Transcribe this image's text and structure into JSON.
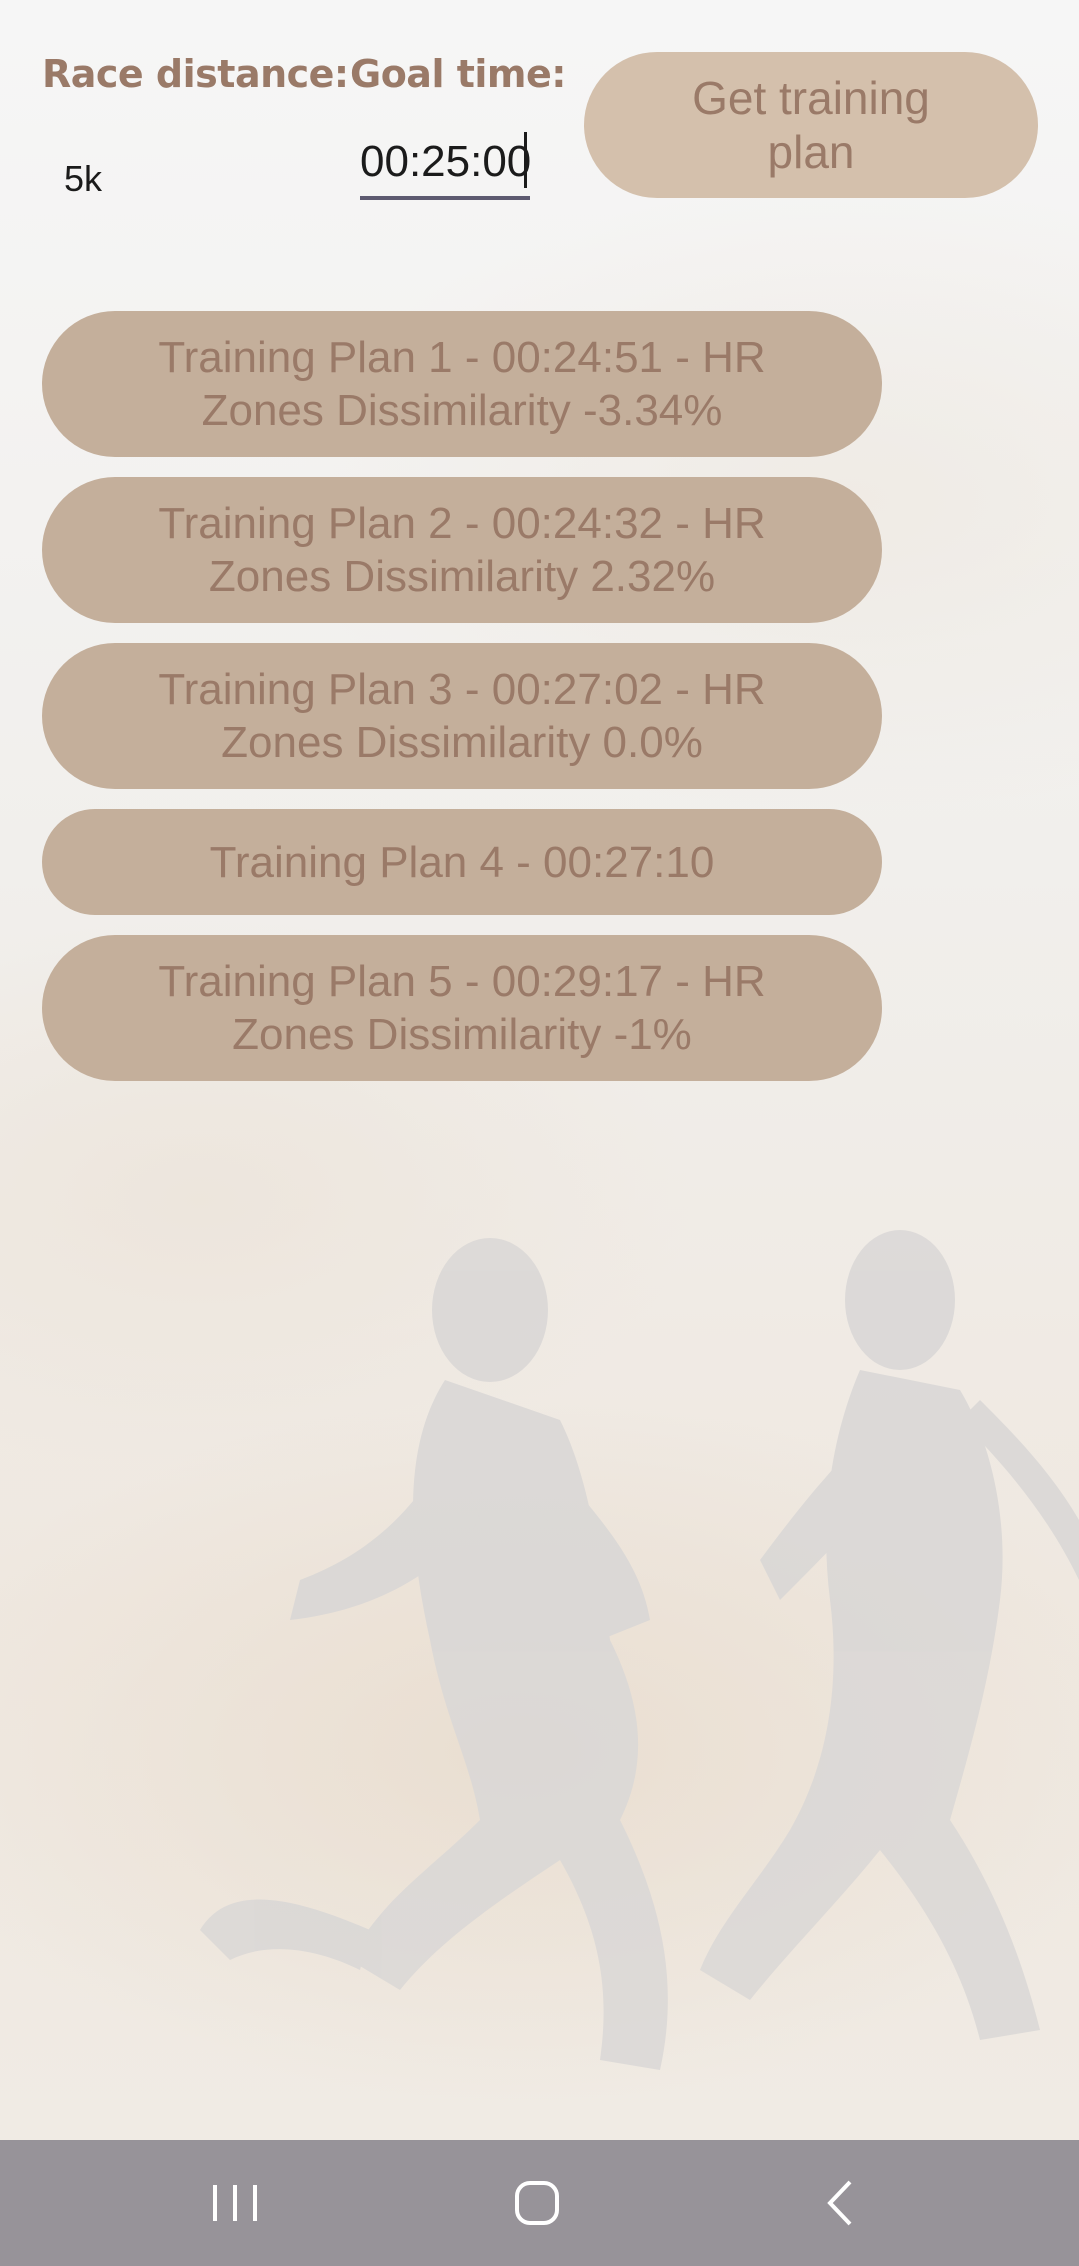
{
  "form": {
    "race_distance_label": "Race distance:",
    "goal_time_label": "Goal time:",
    "race_distance_value": "5k",
    "goal_time_value": "00:25:00",
    "get_plan_label": "Get training plan"
  },
  "plans": [
    "Training Plan 1 - 00:24:51 - HR Zones Dissimilarity -3.34%",
    "Training Plan 2 - 00:24:32 - HR Zones Dissimilarity 2.32%",
    "Training Plan 3 - 00:27:02 - HR Zones Dissimilarity 0.0%",
    "Training Plan 4 - 00:27:10",
    "Training Plan 5 - 00:29:17 - HR Zones Dissimilarity -1%"
  ],
  "navbar": {
    "recents_icon": "recents-icon",
    "home_icon": "home-icon",
    "back_icon": "back-icon"
  },
  "colors": {
    "label_text": "#9a7a68",
    "get_plan_button": "#d4c0ac",
    "plan_button": "#c4af9b",
    "navbar": "#979399"
  }
}
